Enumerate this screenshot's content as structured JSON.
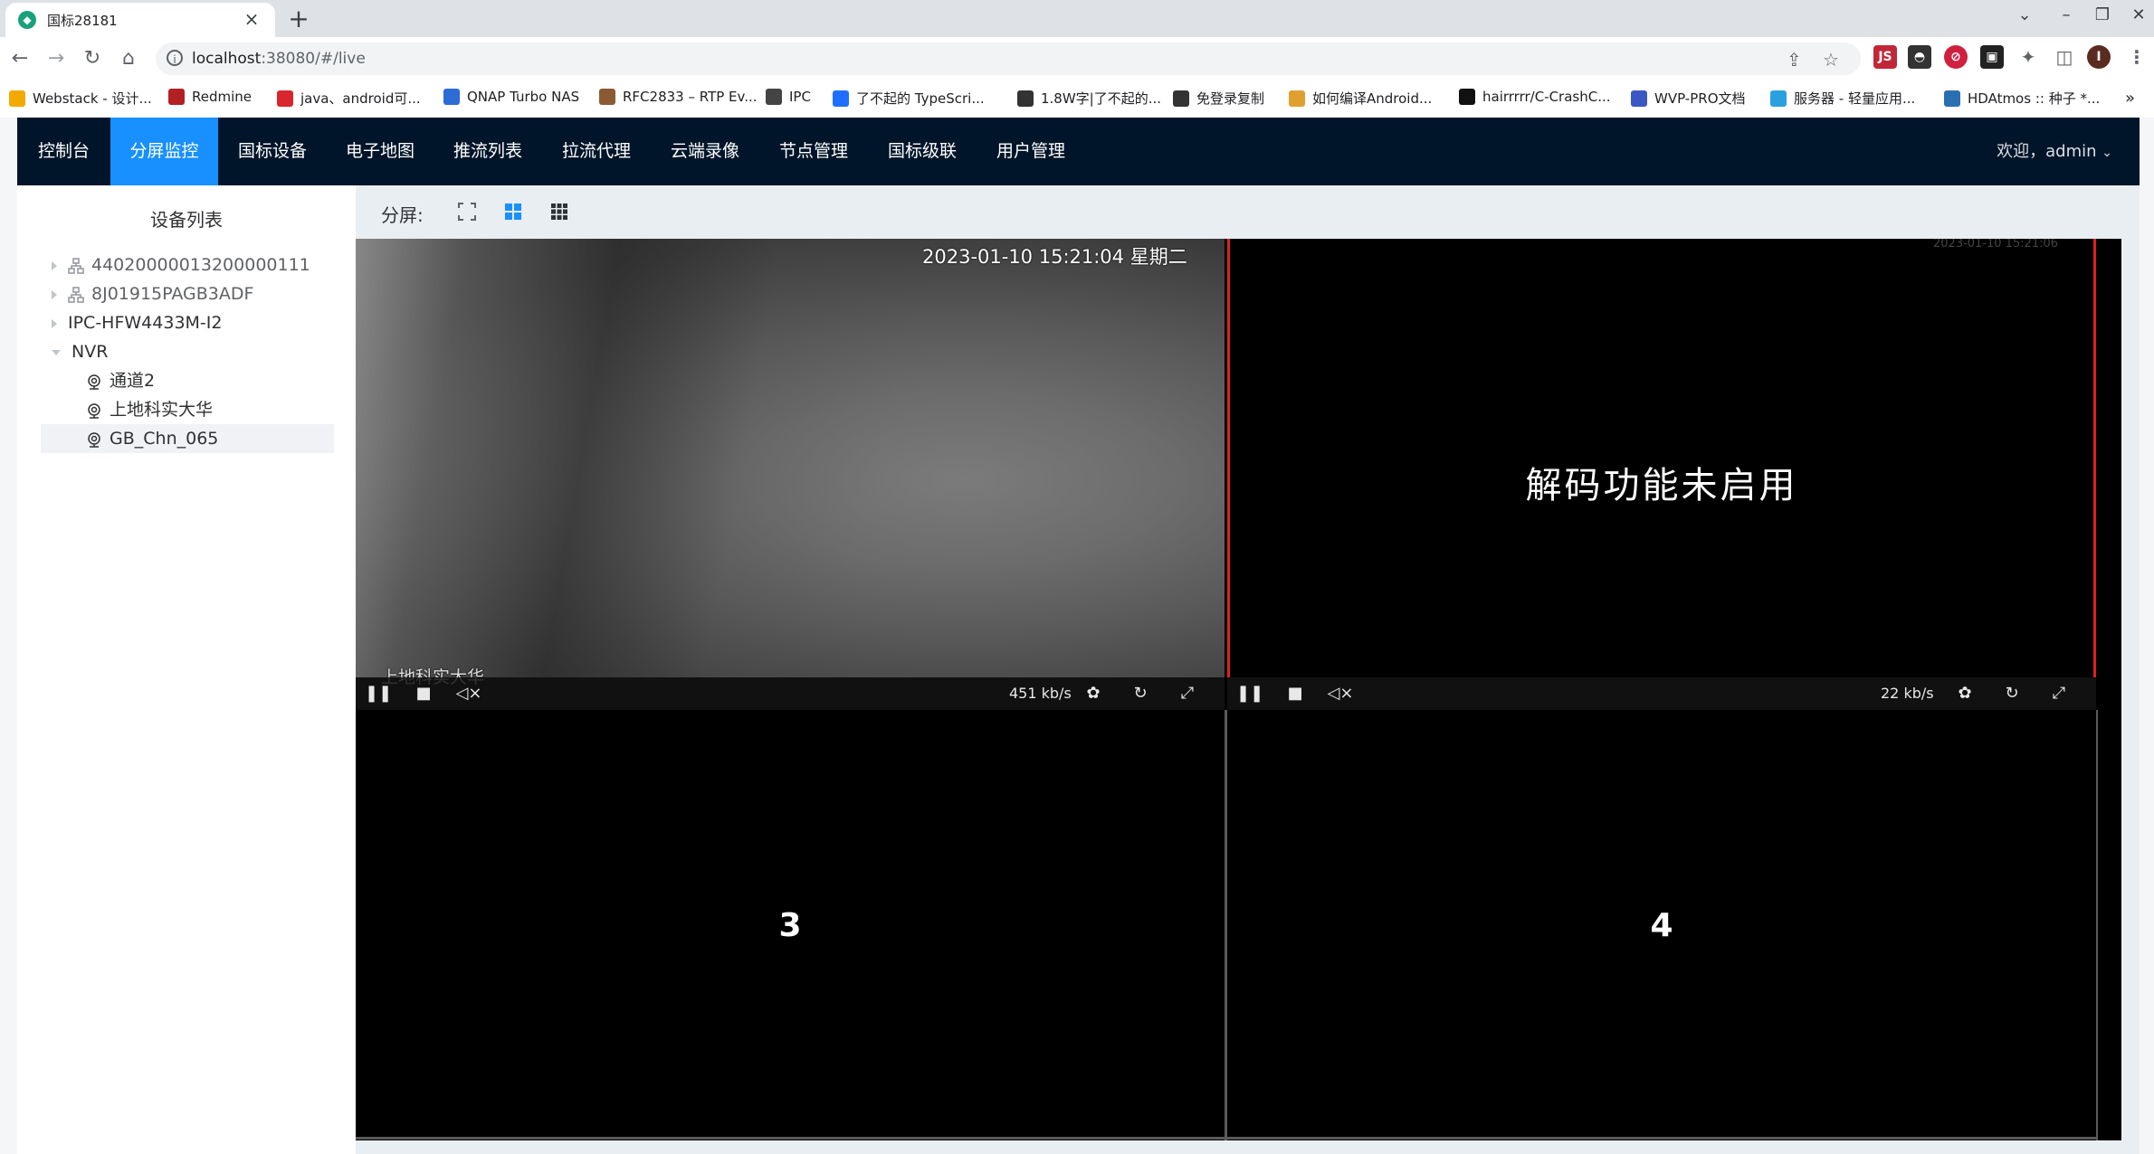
{
  "browser": {
    "tab_title": "国标28181",
    "tab_favicon": "wvp-favicon-icon",
    "url_host": "localhost",
    "url_rest": ":38080/#/live",
    "profile_initial": "I",
    "bookmarks": [
      {
        "label": "Webstack - 设计...",
        "color": "#f2a900"
      },
      {
        "label": "Redmine",
        "color": "#b32024"
      },
      {
        "label": "java、android可...",
        "color": "#d9262c"
      },
      {
        "label": "QNAP Turbo NAS",
        "color": "#2d6bd6"
      },
      {
        "label": "RFC2833 – RTP Ev...",
        "color": "#8a5a33"
      },
      {
        "label": "IPC",
        "color": "#444444"
      },
      {
        "label": "了不起的 TypeScri...",
        "color": "#1e6fff"
      },
      {
        "label": "1.8W字|了不起的...",
        "color": "#333333"
      },
      {
        "label": "免登录复制",
        "color": "#333333"
      },
      {
        "label": "如何编译Android...",
        "color": "#e0a030"
      },
      {
        "label": "hairrrrr/C-CrashC...",
        "color": "#111111"
      },
      {
        "label": "WVP-PRO文档",
        "color": "#3a57c4"
      },
      {
        "label": "服务器 - 轻量应用...",
        "color": "#2aa0e0"
      },
      {
        "label": "HDAtmos :: 种子 *...",
        "color": "#2a6fb0"
      }
    ],
    "bookmark_overflow": "»"
  },
  "nav": {
    "items": [
      "控制台",
      "分屏监控",
      "国标设备",
      "电子地图",
      "推流列表",
      "拉流代理",
      "云端录像",
      "节点管理",
      "国标级联",
      "用户管理"
    ],
    "active_index": 1,
    "welcome": "欢迎，admin"
  },
  "sidebar": {
    "title": "设备列表",
    "tree": [
      {
        "label": "44020000013200000111",
        "level": 0,
        "caret": "right",
        "icon": "network-icon",
        "muted": true
      },
      {
        "label": "8J01915PAGB3ADF",
        "level": 0,
        "caret": "right",
        "icon": "network-icon",
        "muted": true
      },
      {
        "label": "IPC-HFW4433M-I2",
        "level": 0,
        "caret": "right",
        "icon": "",
        "muted": false
      },
      {
        "label": "NVR",
        "level": 0,
        "caret": "down",
        "icon": "",
        "muted": false
      },
      {
        "label": "通道2",
        "level": 1,
        "caret": "",
        "icon": "camera-icon",
        "muted": false
      },
      {
        "label": "上地科实大华",
        "level": 1,
        "caret": "",
        "icon": "camera-icon",
        "muted": false
      },
      {
        "label": "GB_Chn_065",
        "level": 1,
        "caret": "",
        "icon": "camera-icon",
        "muted": false,
        "selected": true
      }
    ]
  },
  "main": {
    "split_label": "分屏:",
    "split_options": [
      "fullscreen-icon",
      "grid-4-icon",
      "grid-9-icon"
    ],
    "active_split": 1
  },
  "players": [
    {
      "osd_time": "2023-01-10 15:21:04 星期二",
      "osd_name": "上地科实大华",
      "bitrate": "451 kb/s"
    },
    {
      "osd_time": "2023-01-10 15:21:06",
      "message": "解码功能未启用",
      "bitrate": "22 kb/s"
    },
    {
      "number": "3"
    },
    {
      "number": "4"
    }
  ],
  "colors": {
    "nav_bg": "#001529",
    "nav_active": "#1890ff",
    "player_active_border": "#e02020"
  }
}
